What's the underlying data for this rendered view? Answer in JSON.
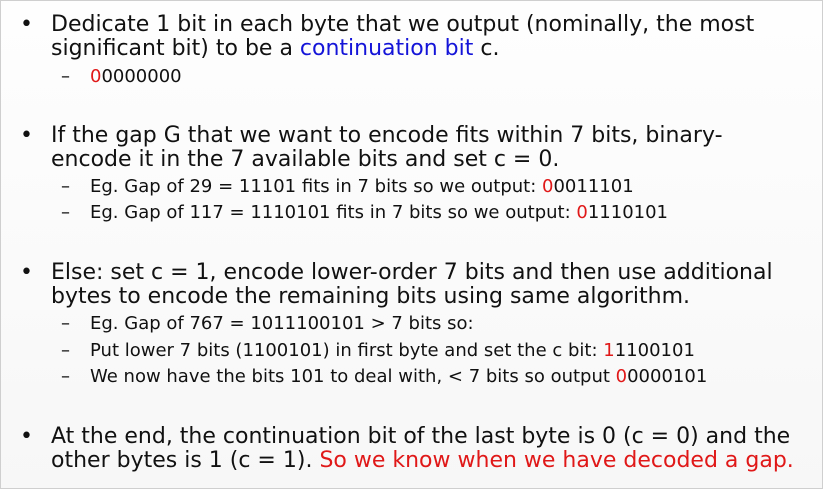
{
  "bullets": [
    {
      "line1_pre": "Dedicate 1 bit in each byte that we output (nominally, the most",
      "line2_pre": "significant bit) to be a ",
      "line2_blue": "continuation bit",
      "line2_post": " c.",
      "subs": [
        {
          "red": "0",
          "rest": "0000000"
        }
      ]
    },
    {
      "line1": "If the gap G that we want to encode fits within 7 bits, binary-",
      "line2": "encode it in the 7 available bits and set c = 0.",
      "subs": [
        {
          "pre": "Eg. Gap of 29 = 11101 fits in 7 bits so we output: ",
          "red": "0",
          "post": "0011101"
        },
        {
          "pre": "Eg. Gap of 117 = 1110101 fits in 7 bits so we output: ",
          "red": "0",
          "post": "1110101"
        }
      ]
    },
    {
      "line1": "Else: set c = 1, encode lower-order 7 bits and then use additional",
      "line2": "bytes to encode the remaining bits using same algorithm.",
      "subs": [
        {
          "pre": "Eg. Gap of 767 = 1011100101 > 7 bits so:"
        },
        {
          "pre": "Put lower 7 bits (1100101) in first byte and set the c bit: ",
          "red": "1",
          "post": "1100101"
        },
        {
          "pre": "We now have the bits 101 to deal with, < 7 bits so output ",
          "red": "0",
          "post": "0000101"
        }
      ]
    },
    {
      "line1": "At the end, the continuation bit of the last byte is 0 (c = 0) and the",
      "line2_pre": "other bytes is 1 (c = 1). ",
      "line2_red": "So we know when we have decoded a gap."
    }
  ],
  "bullet_symbol": "•",
  "dash_symbol": "–"
}
